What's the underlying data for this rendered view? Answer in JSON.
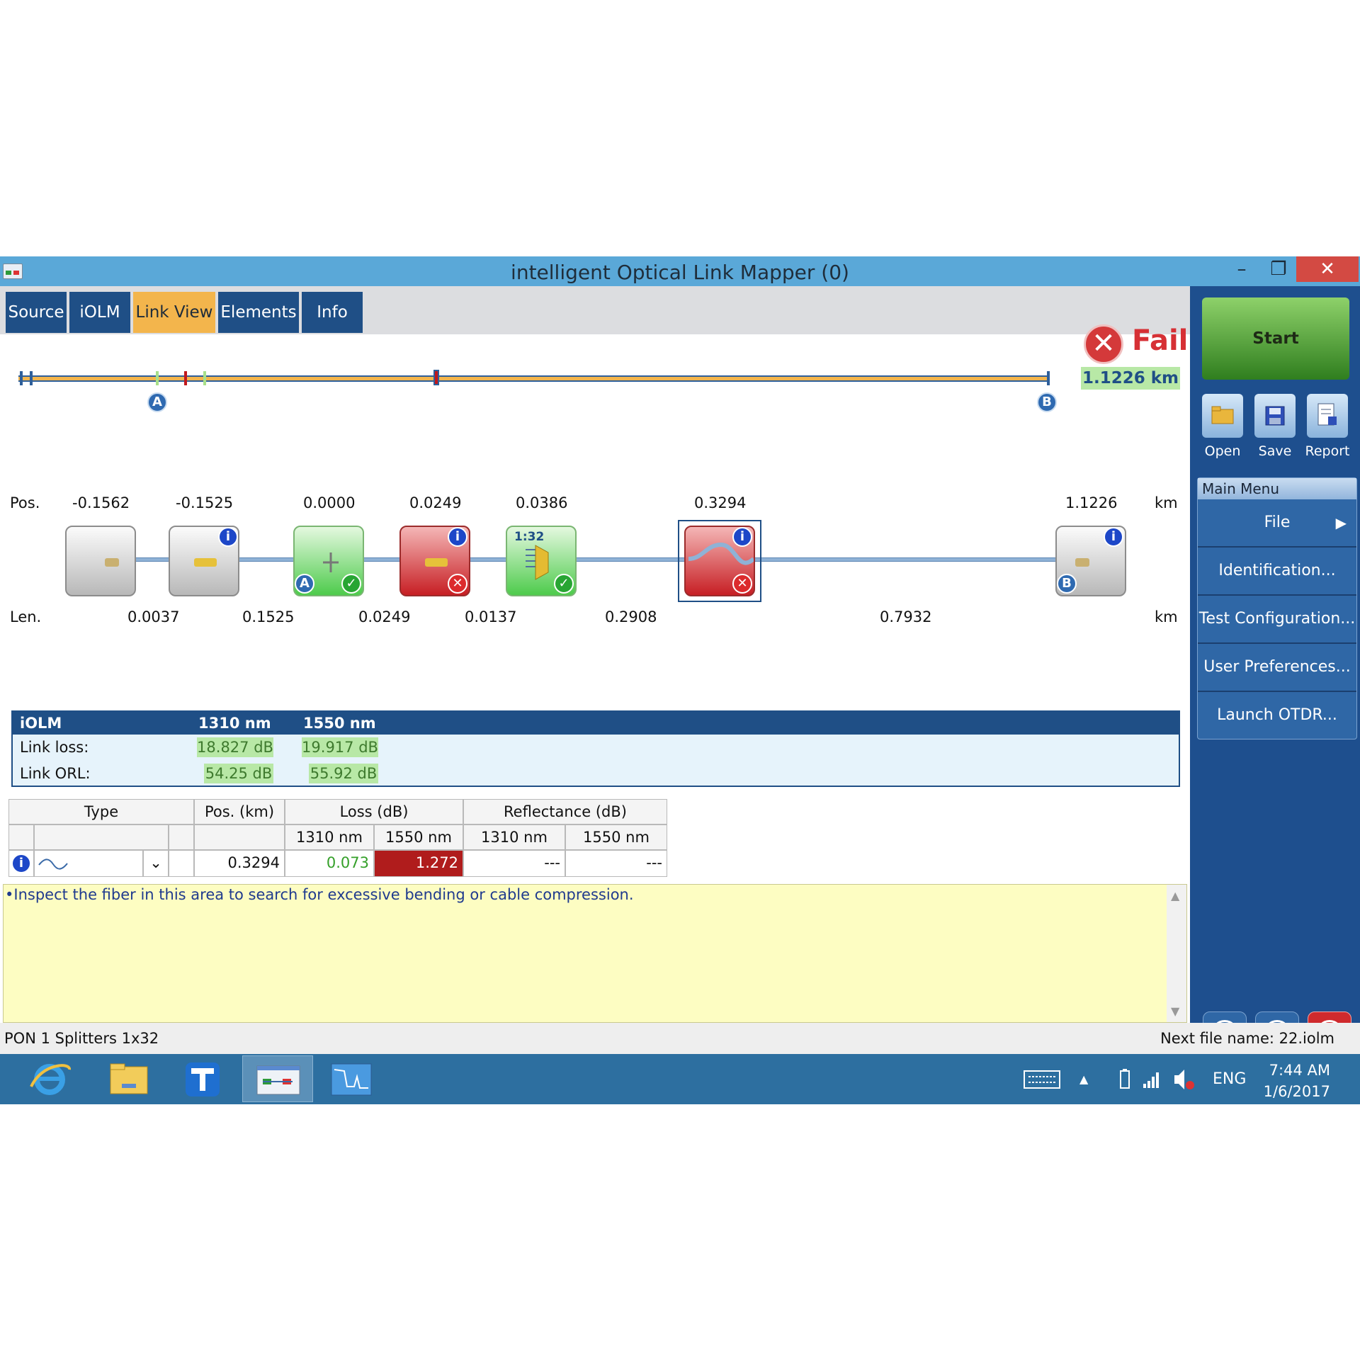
{
  "window": {
    "title": "intelligent Optical Link Mapper (0)",
    "minimize": "–",
    "maximize": "❐",
    "close": "✕"
  },
  "tabs": [
    {
      "label": "Source"
    },
    {
      "label": "iOLM"
    },
    {
      "label": "Link View"
    },
    {
      "label": "Elements"
    },
    {
      "label": "Info"
    }
  ],
  "active_tab": "Link View",
  "status": {
    "icon": "✕",
    "label": "Fail",
    "color": "#d63035"
  },
  "overview": {
    "total_length": "1.1226 km",
    "marker_a": "A",
    "marker_b": "B"
  },
  "link": {
    "pos_label": "Pos.",
    "len_label": "Len.",
    "unit": "km",
    "positions": [
      "-0.1562",
      "-0.1525",
      "0.0000",
      "0.0249",
      "0.0386",
      "0.3294",
      "1.1226"
    ],
    "lengths": [
      "0.0037",
      "0.1525",
      "0.0249",
      "0.0137",
      "0.2908",
      "0.7932"
    ],
    "splitter_ratio": "1:32"
  },
  "summary": {
    "title": "iOLM",
    "wl1": "1310 nm",
    "wl2": "1550 nm",
    "rows": [
      {
        "label": "Link loss:",
        "v1": "18.827 dB",
        "v2": "19.917 dB"
      },
      {
        "label": "Link ORL:",
        "v1": "54.25 dB",
        "v2": "55.92 dB"
      }
    ]
  },
  "table": {
    "headers": {
      "type": "Type",
      "pos": "Pos. (km)",
      "loss": "Loss (dB)",
      "refl": "Reflectance (dB)"
    },
    "sub": {
      "l1310": "1310 nm",
      "l1550": "1550 nm",
      "r1310": "1310 nm",
      "r1550": "1550 nm"
    },
    "row": {
      "pos": "0.3294",
      "loss1310": "0.073",
      "loss1550": "1.272",
      "refl1310": "---",
      "refl1550": "---"
    }
  },
  "notes": "•Inspect the fiber in this area to search for excessive bending or cable compression.",
  "statusbar": {
    "left": "PON 1 Splitters 1x32",
    "right": "Next file name: 22.iolm"
  },
  "sidebar": {
    "start": "Start",
    "tools": [
      {
        "label": "Open"
      },
      {
        "label": "Save"
      },
      {
        "label": "Report"
      }
    ],
    "menu_title": "Main Menu",
    "menu": [
      {
        "label": "File"
      },
      {
        "label": "Identification..."
      },
      {
        "label": "Test Configuration..."
      },
      {
        "label": "User Preferences..."
      },
      {
        "label": "Launch OTDR..."
      }
    ]
  },
  "taskbar": {
    "lang": "ENG",
    "time": "7:44 AM",
    "date": "1/6/2017"
  }
}
